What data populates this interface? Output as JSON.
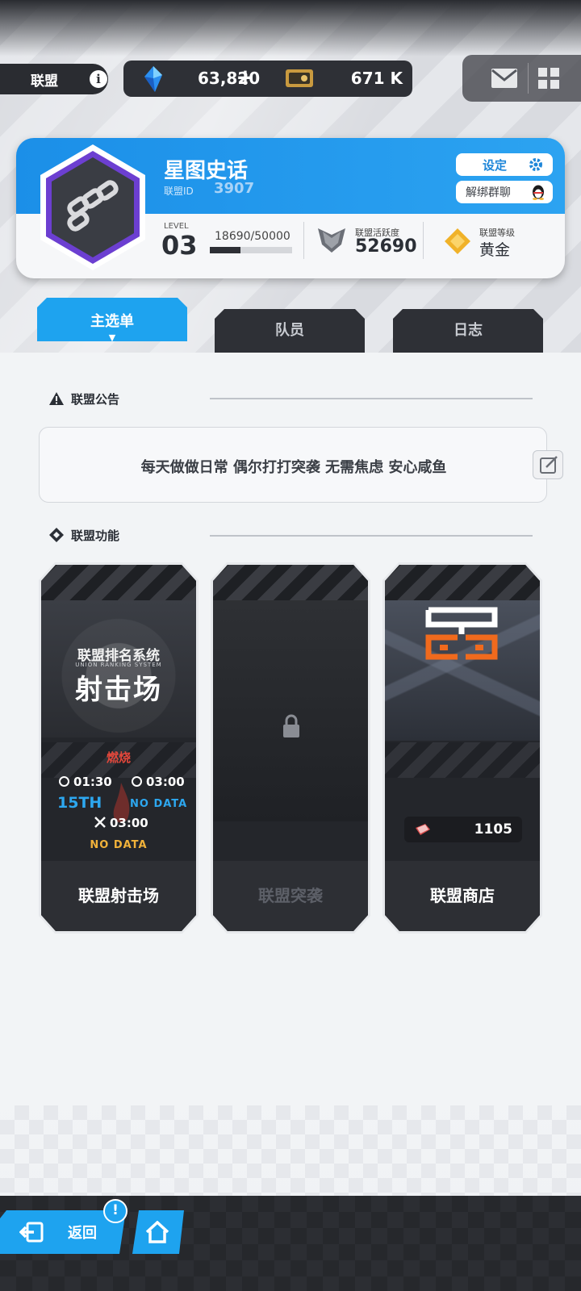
{
  "header": {
    "title": "联盟",
    "currency_crystal": "63,820",
    "plus_symbol": "+",
    "currency_ticket": "671 K"
  },
  "profile": {
    "guild_name": "星图史话",
    "id_label": "联盟ID",
    "id_value": "3907",
    "settings_label": "设定",
    "unbind_label": "解绑群聊",
    "level_label": "LEVEL",
    "level_value": "03",
    "exp_text": "18690/50000",
    "exp_fraction": 0.3738,
    "activity_label": "联盟活跃度",
    "activity_value": "52690",
    "rank_label": "联盟等级",
    "rank_value": "黄金"
  },
  "tabs": [
    {
      "label": "主选单",
      "active": true
    },
    {
      "label": "队员",
      "active": false
    },
    {
      "label": "日志",
      "active": false
    }
  ],
  "notice": {
    "title": "联盟公告",
    "text": "每天做做日常 偶尔打打突袭 无需焦虑 安心咸鱼"
  },
  "features": {
    "title": "联盟功能",
    "shooting": {
      "subtitle": "联盟排名系统",
      "subtitle_en": "UNION RANKING SYSTEM",
      "art_title": "射击场",
      "mode": "燃烧",
      "time1": "01:30",
      "time2": "03:00",
      "rank1": "15TH",
      "rank2": "NO DATA",
      "time3": "03:00",
      "rank3": "NO DATA",
      "label": "联盟射击场"
    },
    "raid": {
      "label": "联盟突袭",
      "locked": true
    },
    "shop": {
      "coins": "1105",
      "label": "联盟商店"
    }
  },
  "bottom": {
    "back_label": "返回",
    "alert_badge": "!"
  },
  "colors": {
    "accent_blue": "#1ea3ef",
    "dark_panel": "#2e3036",
    "burn_red": "#e2473b",
    "gold": "#f1b23a"
  }
}
